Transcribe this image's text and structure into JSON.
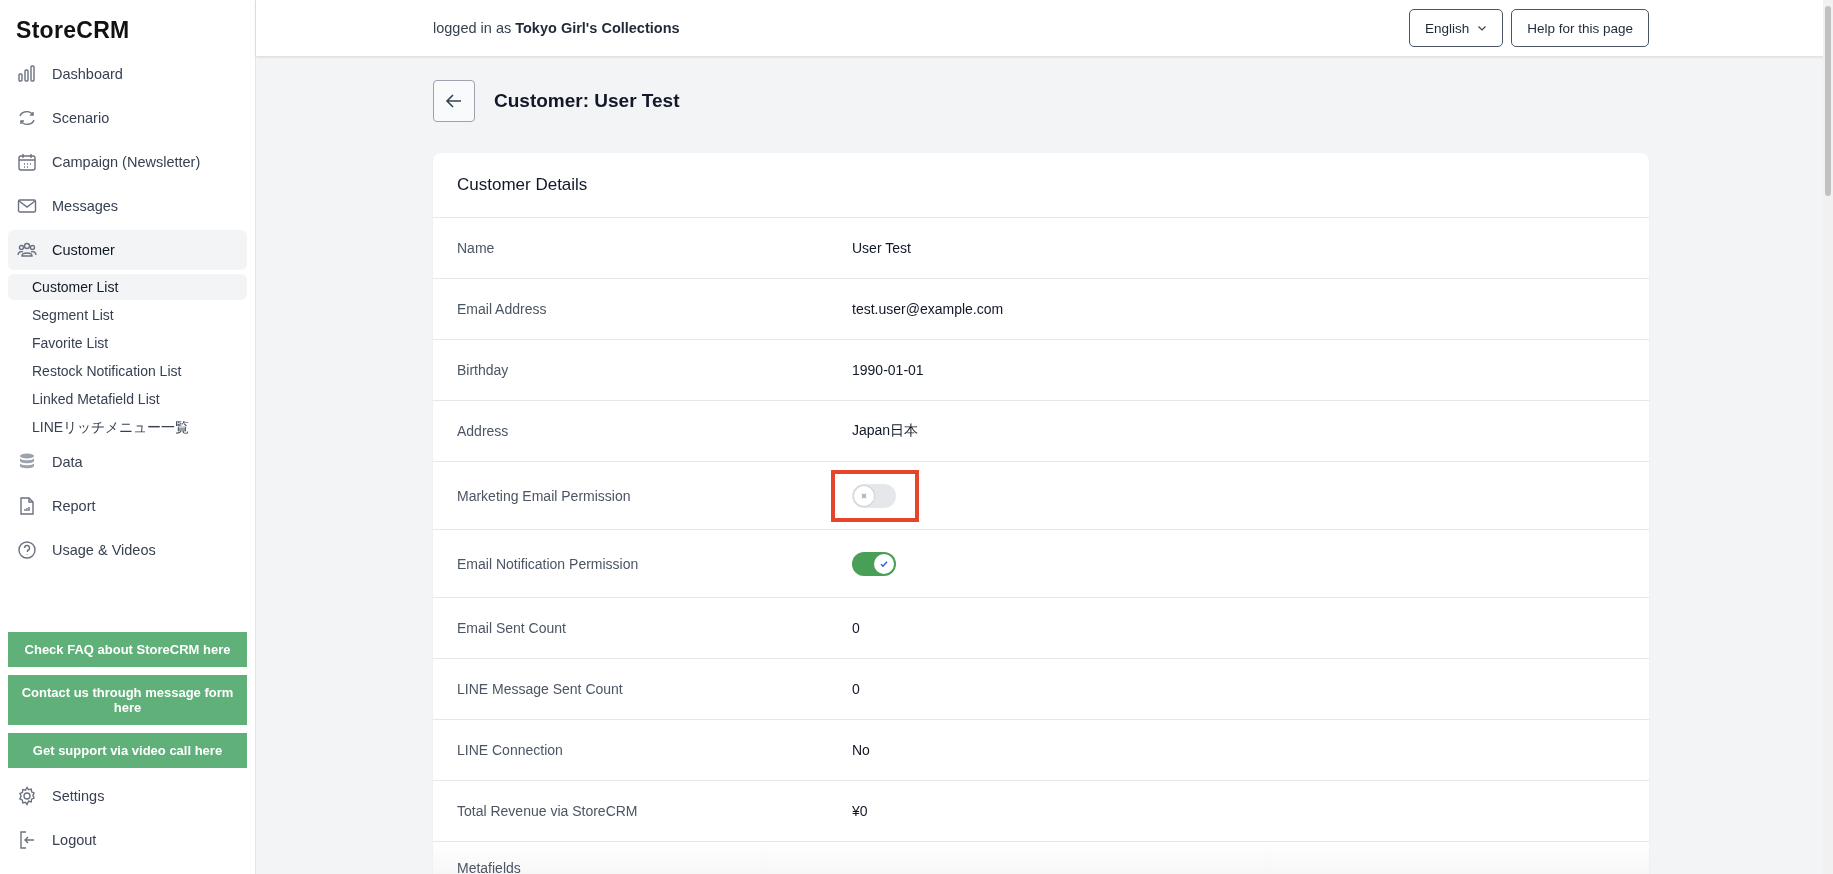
{
  "sidebar": {
    "logo": "StoreCRM",
    "items": [
      {
        "label": "Dashboard",
        "selected": false
      },
      {
        "label": "Scenario",
        "selected": false
      },
      {
        "label": "Campaign (Newsletter)",
        "selected": false
      },
      {
        "label": "Messages",
        "selected": false
      },
      {
        "label": "Customer",
        "selected": true,
        "children": [
          {
            "label": "Customer List",
            "selected": true
          },
          {
            "label": "Segment List",
            "selected": false
          },
          {
            "label": "Favorite List",
            "selected": false
          },
          {
            "label": "Restock Notification List",
            "selected": false
          },
          {
            "label": "Linked Metafield List",
            "selected": false
          },
          {
            "label": "LINEリッチメニュー一覧",
            "selected": false
          }
        ]
      },
      {
        "label": "Data",
        "selected": false
      },
      {
        "label": "Report",
        "selected": false
      },
      {
        "label": "Usage & Videos",
        "selected": false
      }
    ],
    "support_buttons": [
      "Check FAQ about StoreCRM here",
      "Contact us through message form here",
      "Get support via video call here"
    ],
    "bottom_items": [
      {
        "label": "Settings"
      },
      {
        "label": "Logout"
      }
    ]
  },
  "header": {
    "logged_in": "logged in as **Tokyo Girl's Collections**",
    "language": "English",
    "help_button": "Help for this page"
  },
  "page": {
    "title": "Customer: User Test",
    "card_title": "Customer Details",
    "fields": [
      {
        "label": "Name",
        "kind": "text",
        "value": "User Test"
      },
      {
        "label": "Email Address",
        "kind": "text",
        "value": "test.user@example.com"
      },
      {
        "label": "Birthday",
        "kind": "text",
        "value": "1990-01-01"
      },
      {
        "label": "Address",
        "kind": "text",
        "value": "Japan日本"
      },
      {
        "label": "Marketing Email Permission",
        "kind": "toggle",
        "on": false,
        "highlighted": true
      },
      {
        "label": "Email Notification Permission",
        "kind": "toggle",
        "on": true,
        "highlighted": false
      },
      {
        "label": "Email Sent Count",
        "kind": "text",
        "value": "0"
      },
      {
        "label": "LINE Message Sent Count",
        "kind": "text",
        "value": "0"
      },
      {
        "label": "LINE Connection",
        "kind": "text",
        "value": "No"
      },
      {
        "label": "Total Revenue via StoreCRM",
        "kind": "text",
        "value": "¥0"
      }
    ],
    "next_section": "Metafields"
  }
}
